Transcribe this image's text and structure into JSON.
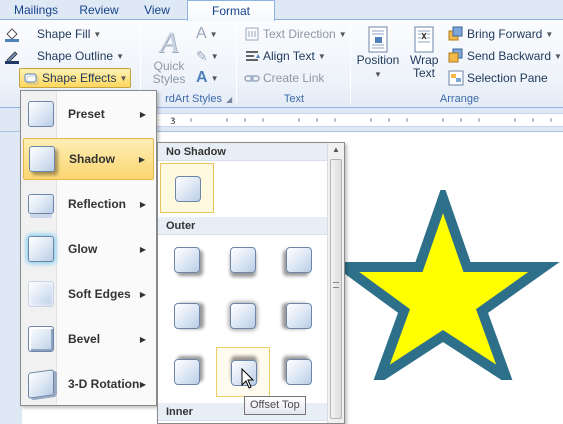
{
  "tabs": [
    "Mailings",
    "Review",
    "View",
    "Format"
  ],
  "active_tab": "Format",
  "ribbon": {
    "shape_styles": {
      "shape_fill": "Shape Fill",
      "shape_outline": "Shape Outline",
      "shape_effects": "Shape Effects"
    },
    "wordart": {
      "quick_styles": "Quick Styles",
      "label_fragment": "rdArt Styles"
    },
    "text": {
      "text_direction": "Text Direction",
      "align_text": "Align Text",
      "create_link": "Create Link",
      "label": "Text"
    },
    "arrange": {
      "position": "Position",
      "wrap_text": "Wrap Text",
      "bring_forward": "Bring Forward",
      "send_backward": "Send Backward",
      "selection_pane": "Selection Pane",
      "label": "Arrange"
    }
  },
  "effects_menu": [
    {
      "label": "Preset"
    },
    {
      "label": "Shadow"
    },
    {
      "label": "Reflection"
    },
    {
      "label": "Glow"
    },
    {
      "label": "Soft Edges"
    },
    {
      "label": "Bevel"
    },
    {
      "label": "3-D Rotation"
    }
  ],
  "active_menu_item": "Shadow",
  "shadow_gallery": {
    "sections": [
      "No Shadow",
      "Outer",
      "Inner"
    ],
    "hovered": "Offset Top"
  },
  "tooltip": "Offset Top",
  "colors": {
    "star_fill": "#ffff00",
    "star_outline": "#2e7089",
    "accent_active": "#fcd672"
  }
}
